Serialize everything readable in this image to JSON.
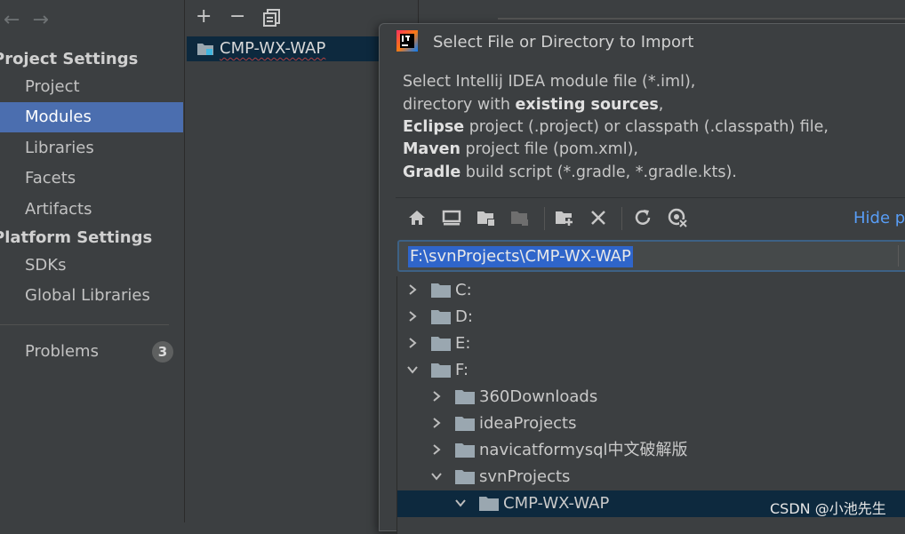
{
  "sidebar": {
    "nav": {
      "back": "←",
      "forward": "→"
    },
    "section_project": "Project Settings",
    "items_project": [
      "Project",
      "Modules",
      "Libraries",
      "Facets",
      "Artifacts"
    ],
    "section_platform": "Platform Settings",
    "items_platform": [
      "SDKs",
      "Global Libraries"
    ],
    "problems": {
      "label": "Problems",
      "count": "3"
    }
  },
  "modules_panel": {
    "toolbar": {
      "add": "+",
      "remove": "−",
      "copy": "copy-icon"
    },
    "module_name": "CMP-WX-WAP"
  },
  "dialog": {
    "title": "Select File or Directory to Import",
    "description": {
      "line1": "Select Intellij IDEA module file (*.iml),",
      "line2_pre": "directory with ",
      "line2_bold": "existing sources",
      "line2_post": ",",
      "line3_bold": "Eclipse",
      "line3_post": " project (.project) or classpath (.classpath) file,",
      "line4_bold": "Maven",
      "line4_post": " project file (pom.xml),",
      "line5_bold": "Gradle",
      "line5_post": " build script (*.gradle, *.gradle.kts)."
    },
    "toolbar_icons": [
      "home-icon",
      "desktop-icon",
      "project-folder-icon",
      "module-folder-icon",
      "new-folder-icon",
      "delete-icon",
      "refresh-icon",
      "show-hidden-icon"
    ],
    "hide_path_label": "Hide p",
    "path_value": "F:\\svnProjects\\CMP-WX-WAP",
    "tree": [
      {
        "name": "C:",
        "expanded": false
      },
      {
        "name": "D:",
        "expanded": false
      },
      {
        "name": "E:",
        "expanded": false
      },
      {
        "name": "F:",
        "expanded": true
      },
      {
        "name": "360Downloads",
        "expanded": false
      },
      {
        "name": "ideaProjects",
        "expanded": false
      },
      {
        "name": "navicatformysql中文破解版",
        "expanded": false
      },
      {
        "name": "svnProjects",
        "expanded": true
      },
      {
        "name": "CMP-WX-WAP",
        "expanded": true,
        "selected": true
      }
    ]
  },
  "watermark": "CSDN @小池先生",
  "colors": {
    "selection": "#4b6eaf",
    "tree_selection": "#0d293e",
    "link": "#589df6",
    "path_highlight": "#2f65ca"
  }
}
